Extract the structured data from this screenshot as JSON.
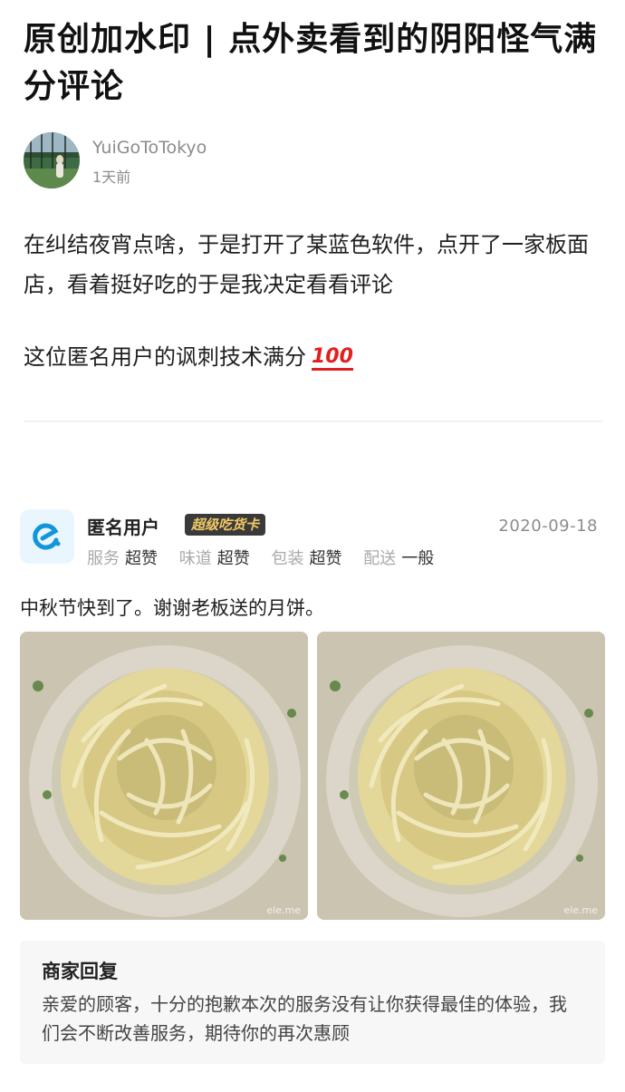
{
  "post": {
    "title": "原创加水印 | 点外卖看到的阴阳怪气满分评论",
    "author": "YuiGoToTokyo",
    "time": "1天前",
    "body_line1": "在纠结夜宵点啥，于是打开了某蓝色软件，点开了一家板面店，看着挺好吃的于是我决定看看评论",
    "body_line2": "这位匿名用户的讽刺技术满分",
    "hundred_emoji": "100"
  },
  "review": {
    "user": "匿名用户",
    "badge": "超级吃货卡",
    "date": "2020-09-18",
    "ratings": [
      {
        "label": "服务",
        "value": "超赞"
      },
      {
        "label": "味道",
        "value": "超赞"
      },
      {
        "label": "包装",
        "value": "超赞"
      },
      {
        "label": "配送",
        "value": "一般"
      }
    ],
    "text": "中秋节快到了。谢谢老板送的月饼。",
    "photo_watermark": "ele.me"
  },
  "reply": {
    "title": "商家回复",
    "text": "亲爱的顾客，十分的抱歉本次的服务没有让你获得最佳的体验，我们会不断改善服务，期待你的再次惠顾"
  },
  "colors": {
    "app_brand": "#1296db",
    "badge_bg": "#3a3a3a",
    "badge_text": "#f2c866",
    "emoji_red": "#e02020"
  }
}
